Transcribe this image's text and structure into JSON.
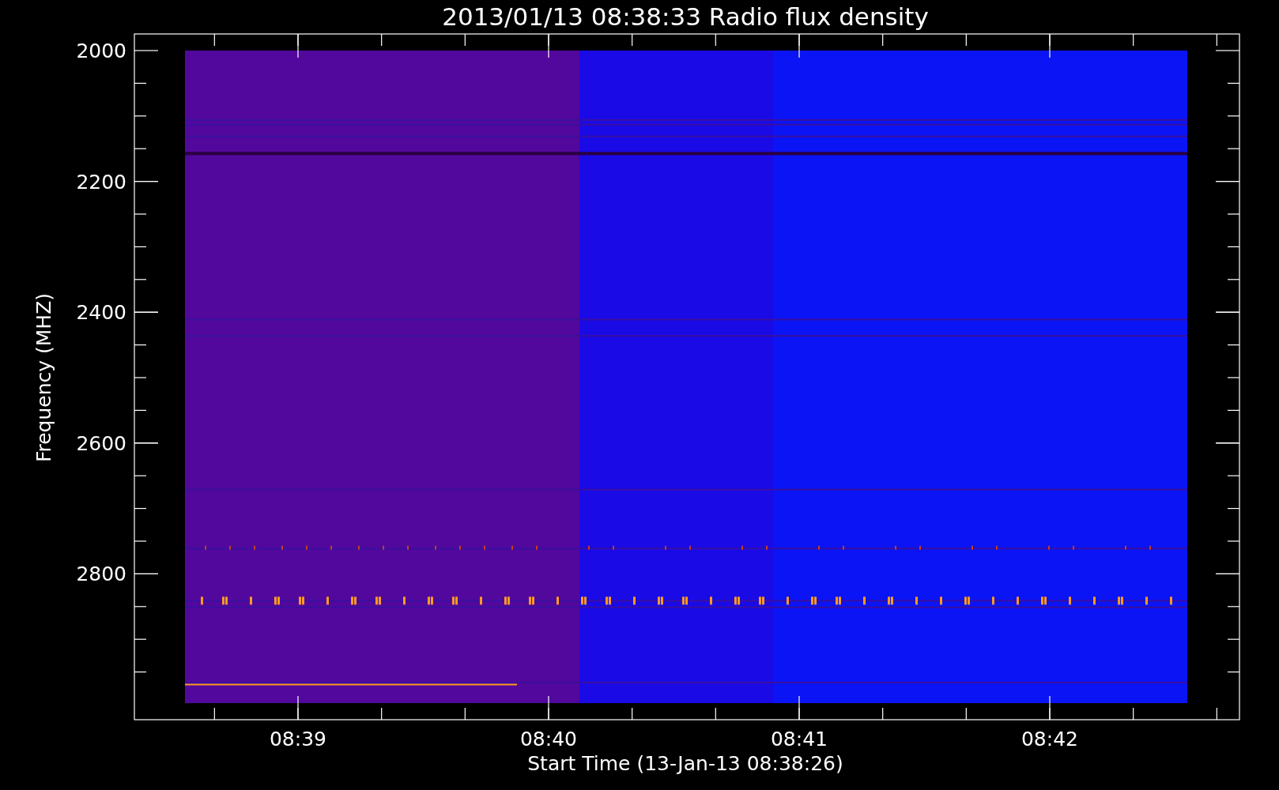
{
  "title": "2013/01/13 08:38:33 Radio flux density",
  "y_axis": {
    "label": "Frequency (MHZ)",
    "ticks": [
      "2000",
      "2200",
      "2400",
      "2600",
      "2800"
    ]
  },
  "x_axis": {
    "label": "Start Time (13-Jan-13 08:38:26)",
    "ticks": [
      "08:39",
      "08:40",
      "08:41",
      "08:42"
    ]
  }
}
